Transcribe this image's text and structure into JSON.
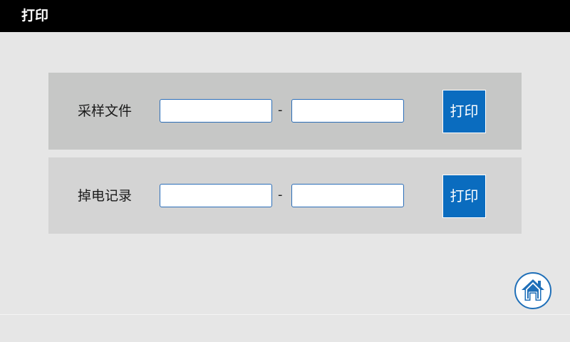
{
  "header": {
    "title": "打印"
  },
  "sections": [
    {
      "label": "采样文件",
      "from_value": "",
      "separator": "-",
      "to_value": "",
      "print_label": "打印"
    },
    {
      "label": "掉电记录",
      "from_value": "",
      "separator": "-",
      "to_value": "",
      "print_label": "打印"
    }
  ],
  "home": {
    "icon": "home-icon"
  },
  "colors": {
    "titlebar": "#000000",
    "background": "#e6e6e6",
    "panel_1": "#c6c7c6",
    "panel_2": "#d4d4d4",
    "accent": "#0a6cbf"
  }
}
